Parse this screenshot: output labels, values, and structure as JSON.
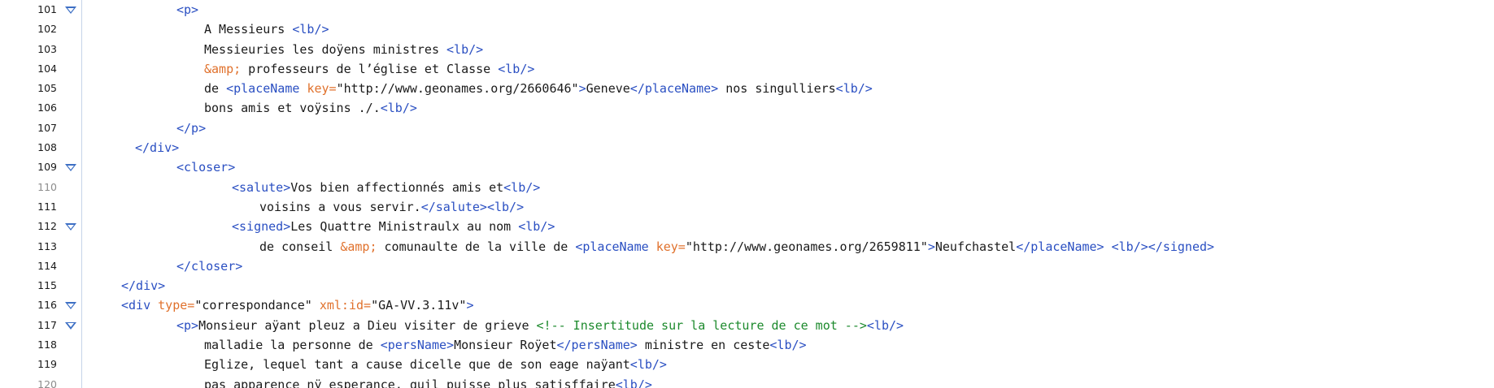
{
  "editor": {
    "colors": {
      "tag": "#2a4fc2",
      "attribute": "#e0712c",
      "entity": "#e0712c",
      "comment": "#1d8a2d",
      "text": "#1a1a1a"
    },
    "lines": [
      {
        "no": "101",
        "fold": true,
        "indent": 6,
        "tokens": [
          [
            "t",
            "<p>"
          ]
        ]
      },
      {
        "no": "102",
        "fold": false,
        "indent": 8,
        "tokens": [
          [
            "x",
            "A Messieurs "
          ],
          [
            "t",
            "<lb/>"
          ]
        ]
      },
      {
        "no": "103",
        "fold": false,
        "indent": 8,
        "tokens": [
          [
            "x",
            "Messieuries les doÿens ministres "
          ],
          [
            "t",
            "<lb/>"
          ]
        ]
      },
      {
        "no": "104",
        "fold": false,
        "indent": 8,
        "tokens": [
          [
            "e",
            "&amp;"
          ],
          [
            "x",
            " professeurs de l’église et Classe "
          ],
          [
            "t",
            "<lb/>"
          ]
        ]
      },
      {
        "no": "105",
        "fold": false,
        "indent": 8,
        "tokens": [
          [
            "x",
            "de "
          ],
          [
            "t",
            "<placeName "
          ],
          [
            "a",
            "key="
          ],
          [
            "v",
            "\"http://www.geonames.org/2660646\""
          ],
          [
            "t",
            ">"
          ],
          [
            "x",
            "Geneve"
          ],
          [
            "t",
            "</placeName>"
          ],
          [
            "x",
            " nos singulliers"
          ],
          [
            "t",
            "<lb/>"
          ]
        ]
      },
      {
        "no": "106",
        "fold": false,
        "indent": 8,
        "tokens": [
          [
            "x",
            "bons amis et voÿsins ./."
          ],
          [
            "t",
            "<lb/>"
          ]
        ]
      },
      {
        "no": "107",
        "fold": false,
        "indent": 6,
        "tokens": [
          [
            "t",
            "</p>"
          ]
        ]
      },
      {
        "no": "108",
        "fold": false,
        "indent": 3,
        "tokens": [
          [
            "t",
            "</div>"
          ]
        ]
      },
      {
        "no": "109",
        "fold": true,
        "indent": 6,
        "tokens": [
          [
            "t",
            "<closer>"
          ]
        ]
      },
      {
        "no": "110",
        "fold": false,
        "indent": 10,
        "dim": true,
        "tokens": [
          [
            "t",
            "<salute>"
          ],
          [
            "x",
            "Vos bien affectionnés amis et"
          ],
          [
            "t",
            "<lb/>"
          ]
        ]
      },
      {
        "no": "111",
        "fold": false,
        "indent": 12,
        "tokens": [
          [
            "x",
            "voisins a vous servir."
          ],
          [
            "t",
            "</salute>"
          ],
          [
            "t",
            "<lb/>"
          ]
        ]
      },
      {
        "no": "112",
        "fold": true,
        "indent": 10,
        "tokens": [
          [
            "t",
            "<signed>"
          ],
          [
            "x",
            "Les Quattre Ministraulx au nom "
          ],
          [
            "t",
            "<lb/>"
          ]
        ]
      },
      {
        "no": "113",
        "fold": false,
        "indent": 12,
        "tokens": [
          [
            "x",
            "de conseil "
          ],
          [
            "e",
            "&amp;"
          ],
          [
            "x",
            " comunaulte de la ville de "
          ],
          [
            "t",
            "<placeName "
          ],
          [
            "a",
            "key="
          ],
          [
            "v",
            "\"http://www.geonames.org/2659811\""
          ],
          [
            "t",
            ">"
          ],
          [
            "x",
            "Neufchastel"
          ],
          [
            "t",
            "</placeName>"
          ],
          [
            "x",
            " "
          ],
          [
            "t",
            "<lb/></signed>"
          ]
        ]
      },
      {
        "no": "114",
        "fold": false,
        "indent": 6,
        "tokens": [
          [
            "t",
            "</closer>"
          ]
        ]
      },
      {
        "no": "115",
        "fold": false,
        "indent": 2,
        "tokens": [
          [
            "t",
            "</div>"
          ]
        ]
      },
      {
        "no": "116",
        "fold": true,
        "indent": 2,
        "tokens": [
          [
            "t",
            "<div "
          ],
          [
            "a",
            "type="
          ],
          [
            "v",
            "\"correspondance\""
          ],
          [
            "x",
            " "
          ],
          [
            "a",
            "xml:id="
          ],
          [
            "v",
            "\"GA-VV.3.11v\""
          ],
          [
            "t",
            ">"
          ]
        ]
      },
      {
        "no": "117",
        "fold": true,
        "indent": 6,
        "tokens": [
          [
            "t",
            "<p>"
          ],
          [
            "x",
            "Monsieur aÿant pleuz a Dieu visiter de grieve "
          ],
          [
            "c",
            "<!-- Insertitude sur la lecture de ce mot -->"
          ],
          [
            "t",
            "<lb/>"
          ]
        ]
      },
      {
        "no": "118",
        "fold": false,
        "indent": 8,
        "tokens": [
          [
            "x",
            "malladie la personne de "
          ],
          [
            "t",
            "<persName>"
          ],
          [
            "x",
            "Monsieur Roÿet"
          ],
          [
            "t",
            "</persName>"
          ],
          [
            "x",
            " ministre en ceste"
          ],
          [
            "t",
            "<lb/>"
          ]
        ]
      },
      {
        "no": "119",
        "fold": false,
        "indent": 8,
        "tokens": [
          [
            "x",
            "Eglize, lequel tant a cause dicelle que de son eage naÿant"
          ],
          [
            "t",
            "<lb/>"
          ]
        ]
      },
      {
        "no": "120",
        "fold": false,
        "indent": 8,
        "dim": true,
        "tokens": [
          [
            "x",
            "pas apparence nÿ esperance, quil puisse plus satisffaire"
          ],
          [
            "t",
            "<lb/>"
          ]
        ]
      }
    ]
  }
}
